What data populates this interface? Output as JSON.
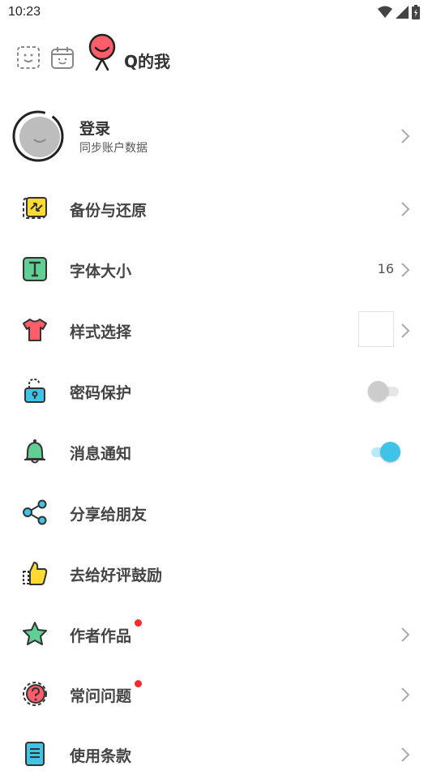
{
  "status_bar": {
    "time": "10:23"
  },
  "header": {
    "title": "Q的我"
  },
  "login": {
    "title": "登录",
    "subtitle": "同步账户数据"
  },
  "menu": [
    {
      "label": "备份与还原"
    },
    {
      "label": "字体大小",
      "value": "16"
    },
    {
      "label": "样式选择"
    },
    {
      "label": "密码保护",
      "toggle_on": false
    },
    {
      "label": "消息通知",
      "toggle_on": true
    },
    {
      "label": "分享给朋友"
    },
    {
      "label": "去给好评鼓励"
    },
    {
      "label": "作者作品",
      "has_dot": true
    },
    {
      "label": "常问问题",
      "has_dot": true
    },
    {
      "label": "使用条款"
    }
  ],
  "colors": {
    "accent": "#3fc4e8",
    "dot": "#ff2a2a",
    "toggle_off": "#cccccc"
  }
}
